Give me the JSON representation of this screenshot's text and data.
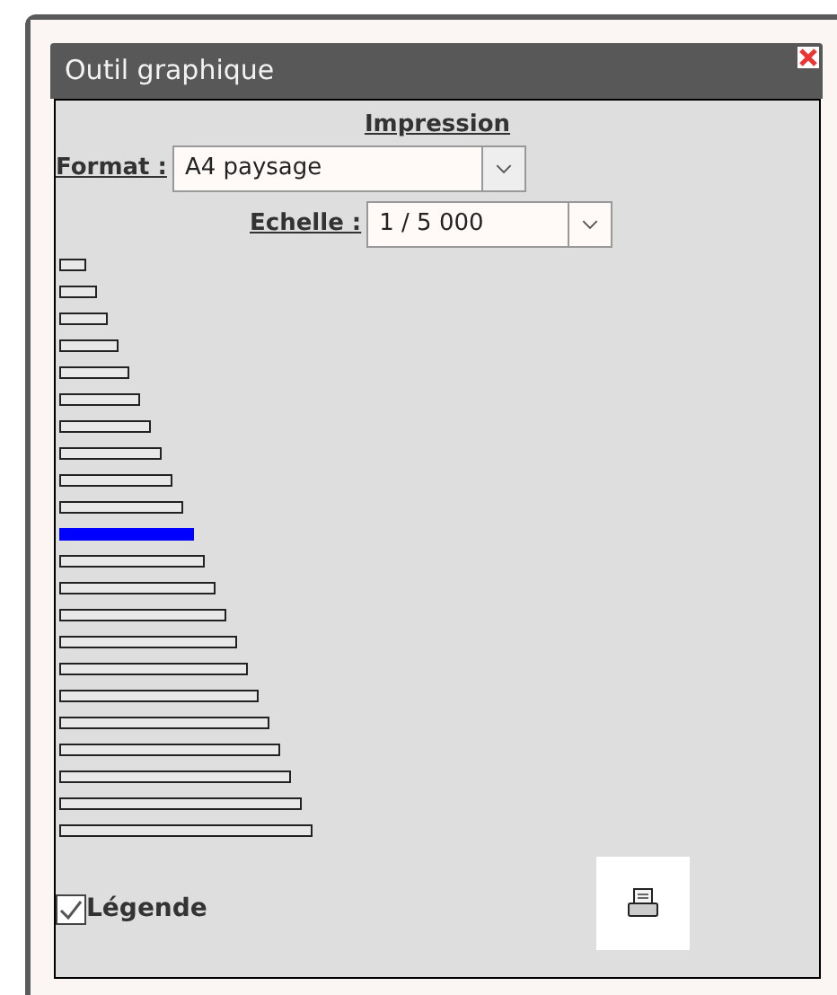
{
  "window": {
    "title": "Outil graphique"
  },
  "heading": "Impression",
  "format": {
    "label": "Format :",
    "value": "A4 paysage"
  },
  "scale": {
    "label": "Echelle :",
    "value": "1 / 5 000"
  },
  "bars": [
    {
      "selected": false
    },
    {
      "selected": false
    },
    {
      "selected": false
    },
    {
      "selected": false
    },
    {
      "selected": false
    },
    {
      "selected": false
    },
    {
      "selected": false
    },
    {
      "selected": false
    },
    {
      "selected": false
    },
    {
      "selected": false
    },
    {
      "selected": true
    },
    {
      "selected": false
    },
    {
      "selected": false
    },
    {
      "selected": false
    },
    {
      "selected": false
    },
    {
      "selected": false
    },
    {
      "selected": false
    },
    {
      "selected": false
    },
    {
      "selected": false
    },
    {
      "selected": false
    },
    {
      "selected": false
    },
    {
      "selected": false
    }
  ],
  "legend": {
    "label": "Légende",
    "checked": true
  }
}
